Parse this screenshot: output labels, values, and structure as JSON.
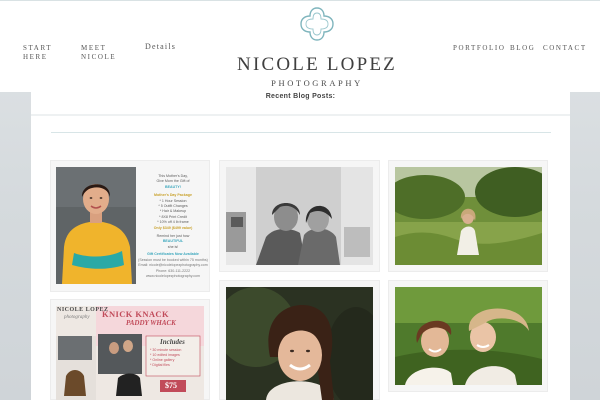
{
  "nav": {
    "left": [
      {
        "line1": "START",
        "line2": "HERE"
      },
      {
        "line1": "MEET",
        "line2": "NICOLE"
      },
      {
        "line1": "Details",
        "line2": ""
      }
    ],
    "right": [
      "PORTFOLIO",
      "BLOG",
      "CONTACT"
    ]
  },
  "brand": {
    "name": "NICOLE LOPEZ",
    "subtitle": "PHOTOGRAPHY",
    "accent_color": "#7fb5bd"
  },
  "main": {
    "section_title": "Recent Blog Posts:"
  },
  "posts": {
    "promo": {
      "line1": "This Mother's Day,",
      "line2": "Give Mom the Gift of",
      "line3": "BEAUTY!",
      "package_title": "Mother's Day Package",
      "items": [
        "* 1 Hour Session",
        "* 5 Outfit Changes",
        "* Hair & Makeup",
        "* 8X8 Print Credit",
        "* 10% off 4 lb frame"
      ],
      "price": "Only $349 ($499 value)",
      "remind_1": "Remind her just how",
      "remind_2": "BEAUTIFUL",
      "remind_3": "she is!",
      "gift_line": "Gift Certificates Now Available",
      "fine_1": "(Session must be booked within 75 months)",
      "fine_2": "Email: nicole@nicolelopezphotography.com",
      "fine_3": "Phone: 630-111-2222",
      "fine_4": "www.nicolelopezphotography.com"
    },
    "flyer": {
      "brand_top": "NICOLE LOPEZ",
      "brand_script": "photography",
      "headline": "KNICK KNACK",
      "headline2": "PADDY WHACK",
      "includes": "Includes",
      "items": [
        "* 30 minute session",
        "* 10 edited images",
        "* Online gallery",
        "* Digital files"
      ],
      "price": "$75"
    }
  }
}
